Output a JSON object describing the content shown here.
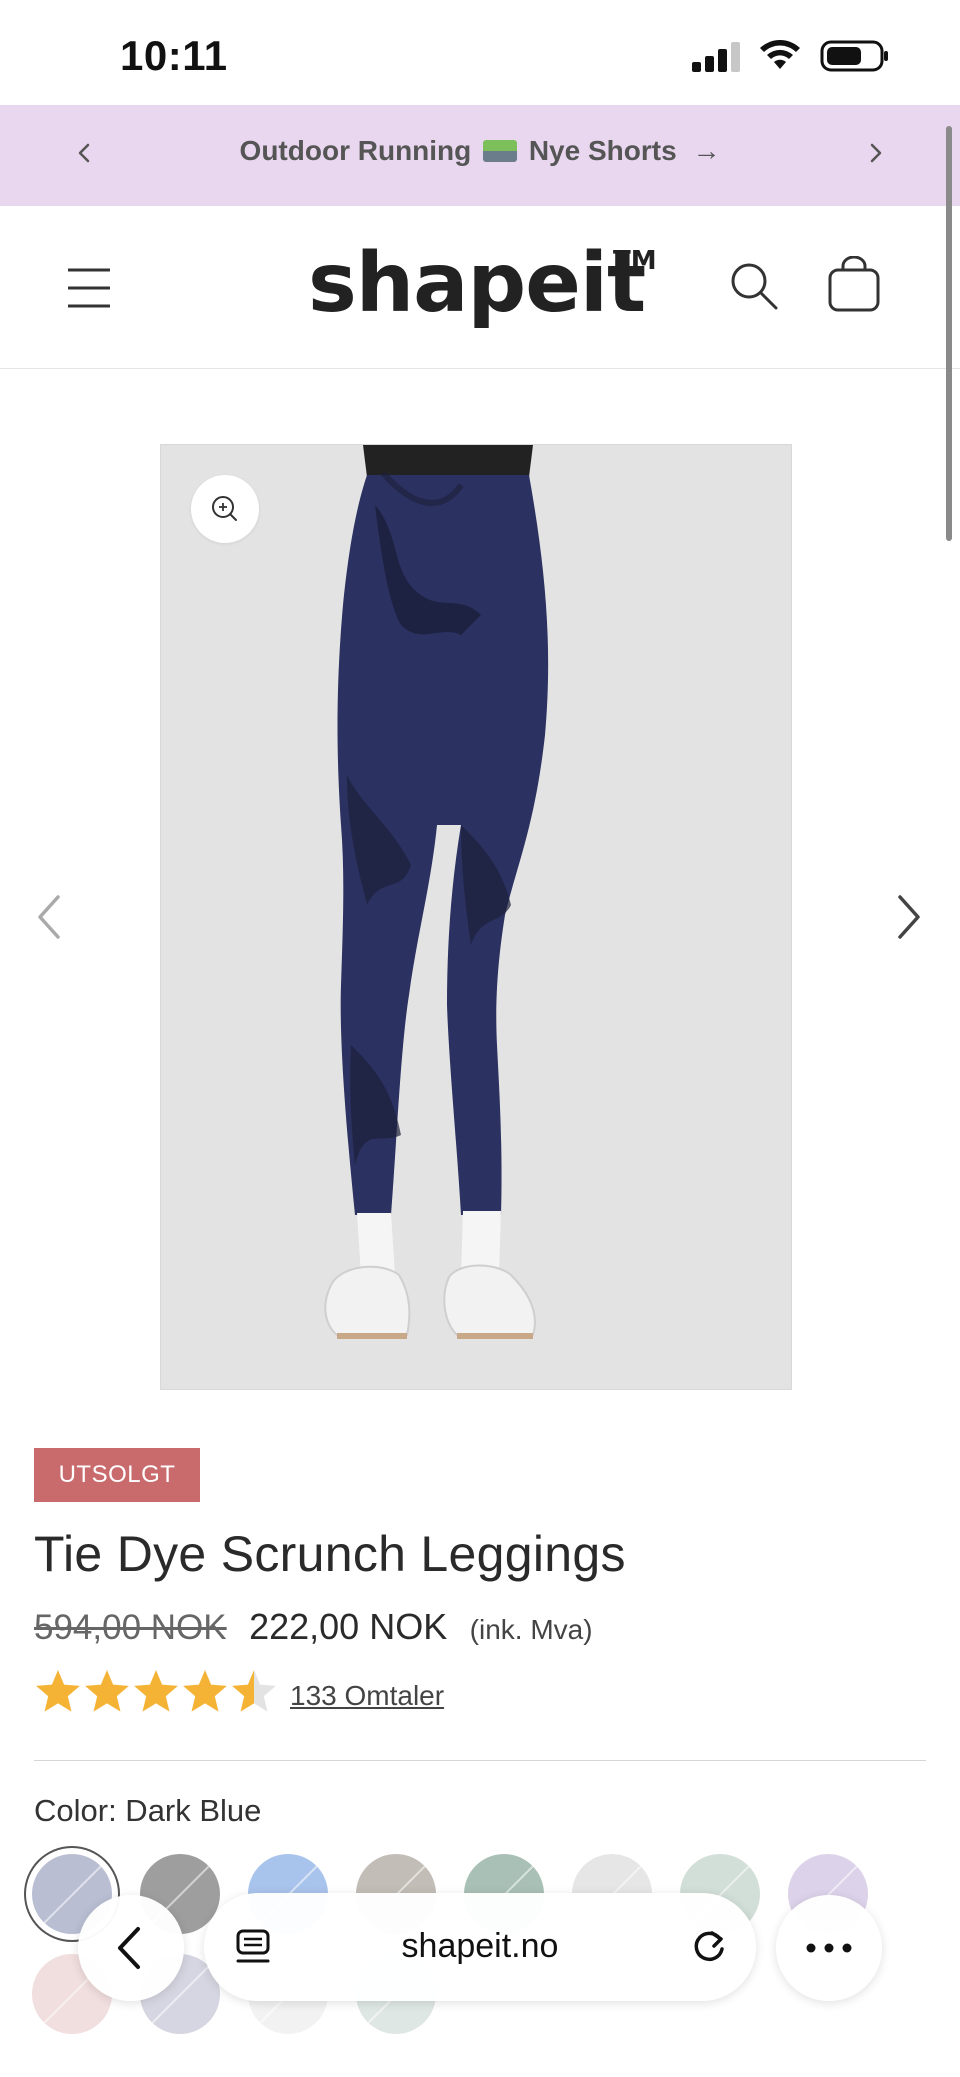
{
  "status_bar": {
    "time": "10:11",
    "icons": [
      "cellular-signal-icon",
      "wifi-icon",
      "battery-icon"
    ]
  },
  "announcement": {
    "text_before": "Outdoor Running",
    "emoji_name": "runner-track-emoji",
    "text_after": "Nye Shorts",
    "arrow": "→",
    "background_color": "#e9d7ef"
  },
  "header": {
    "logo": "shapeit",
    "logo_tm": "TM",
    "icons": [
      "menu-icon",
      "search-icon",
      "cart-icon"
    ]
  },
  "gallery": {
    "icons": [
      "zoom-icon",
      "chevron-left-icon",
      "chevron-right-icon"
    ]
  },
  "product": {
    "badge": "UTSOLGT",
    "badge_color": "#c96a6d",
    "title": "Tie Dye Scrunch Leggings",
    "price_old": "594,00 NOK",
    "price_new": "222,00 NOK",
    "price_tax_note": "(ink. Mva)",
    "rating_value": 4.5,
    "rating_max": 5,
    "reviews_link": "133 Omtaler",
    "color_label": "Color: Dark Blue"
  },
  "swatch_colors": [
    "#b9bed3",
    "#9e9e9e",
    "#a8c3ec",
    "#c2bdb6",
    "#a9c0b6",
    "#e6e6e6",
    "#d2ded8",
    "#dcd2ea",
    "#f1dede",
    "#d6d6e2",
    "#f2f2f2",
    "#dfe7e5"
  ],
  "browser": {
    "address": "shapeit.no",
    "icons": [
      "back-icon",
      "tabs-icon",
      "reload-icon",
      "more-icon"
    ]
  }
}
